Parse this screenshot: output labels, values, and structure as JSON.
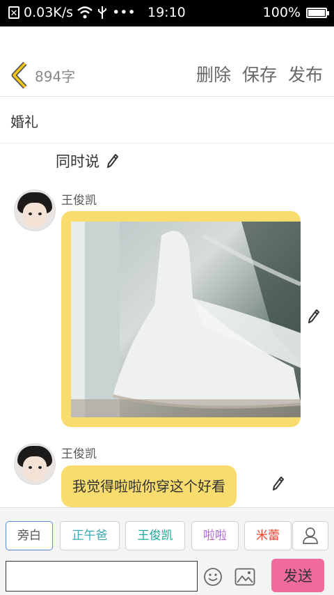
{
  "status_bar": {
    "net_speed": "0.03K/s",
    "more": "•••",
    "time": "19:10",
    "battery_text": "100%",
    "battery_level": 1.0
  },
  "header": {
    "char_count": "894字",
    "delete_label": "删除",
    "save_label": "保存",
    "publish_label": "发布",
    "accent_color": "#f5c518"
  },
  "document": {
    "title": "婚礼"
  },
  "script": {
    "simultaneous_label": "同时说",
    "messages": [
      {
        "speaker": "王俊凯",
        "type": "image",
        "image_desc": "wedding-dress-photo"
      },
      {
        "speaker": "王俊凯",
        "type": "text",
        "text": "我觉得啦啦你穿这个好看"
      }
    ],
    "bubble_color": "#f8dc6d"
  },
  "roles": [
    {
      "label": "旁白",
      "color": "#555555",
      "selected": true
    },
    {
      "label": "正午爸",
      "color": "#3aa6b9"
    },
    {
      "label": "王俊凯",
      "color": "#1aa89a"
    },
    {
      "label": "啦啦",
      "color": "#b06ad8"
    },
    {
      "label": "米蕾",
      "color": "#e8442f"
    }
  ],
  "composer": {
    "input_value": "",
    "send_label": "发送",
    "send_color": "#f06b9d"
  }
}
